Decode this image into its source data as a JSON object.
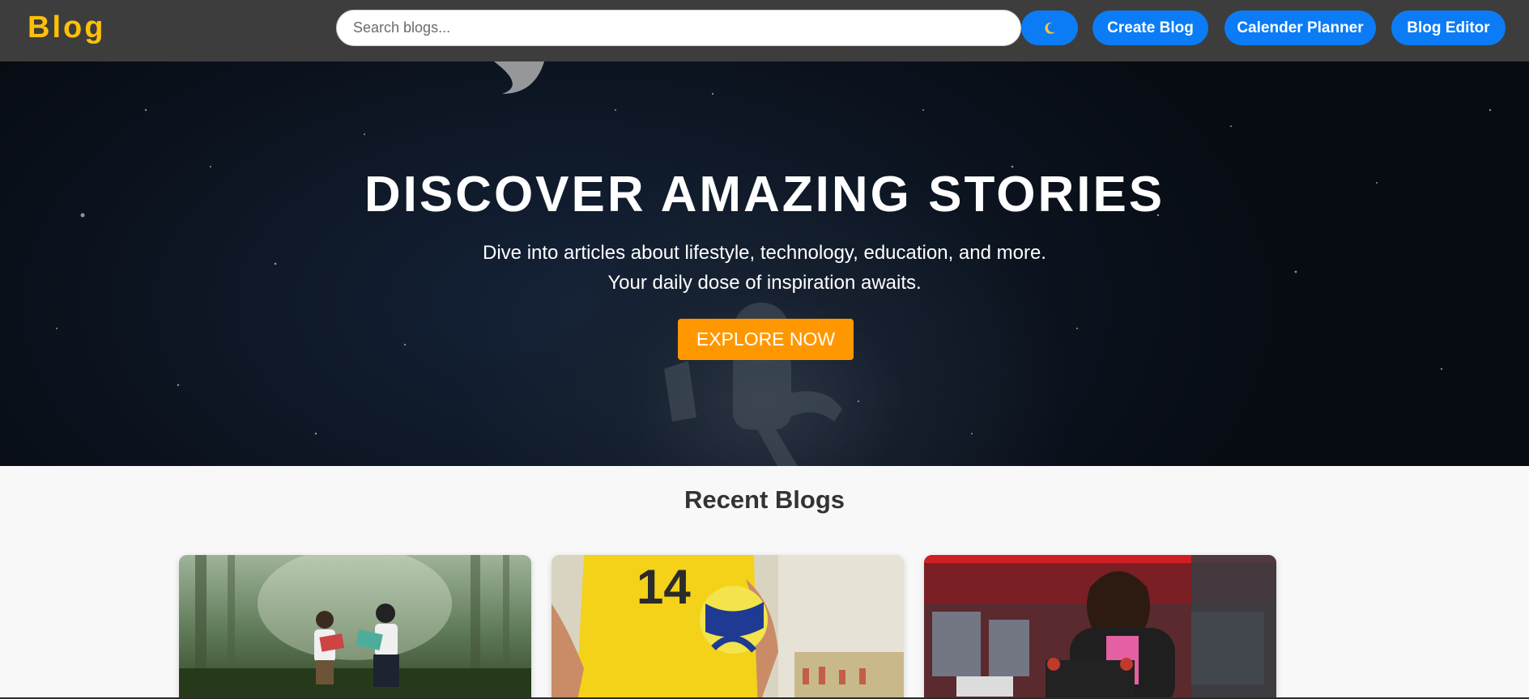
{
  "header": {
    "logo": "Blog",
    "search_placeholder": "Search blogs...",
    "theme_toggle_icon": "moon-icon",
    "buttons": {
      "create": "Create Blog",
      "calendar": "Calender Planner",
      "editor": "Blog Editor"
    }
  },
  "hero": {
    "title": "DISCOVER AMAZING STORIES",
    "subtitle_line1": "Dive into articles about lifestyle, technology, education, and more.",
    "subtitle_line2": "Your daily dose of inspiration awaits.",
    "cta": "EXPLORE NOW"
  },
  "recent": {
    "title": "Recent Blogs",
    "cards": [
      {
        "image": "children-reading-in-forest"
      },
      {
        "image": "volleyball-player-number-14"
      },
      {
        "image": "woman-working-on-electronics"
      }
    ]
  },
  "colors": {
    "header_bg": "#3d3d3d",
    "logo": "#ffc107",
    "button_blue": "#0b7cf5",
    "cta_orange": "#ff9800"
  }
}
